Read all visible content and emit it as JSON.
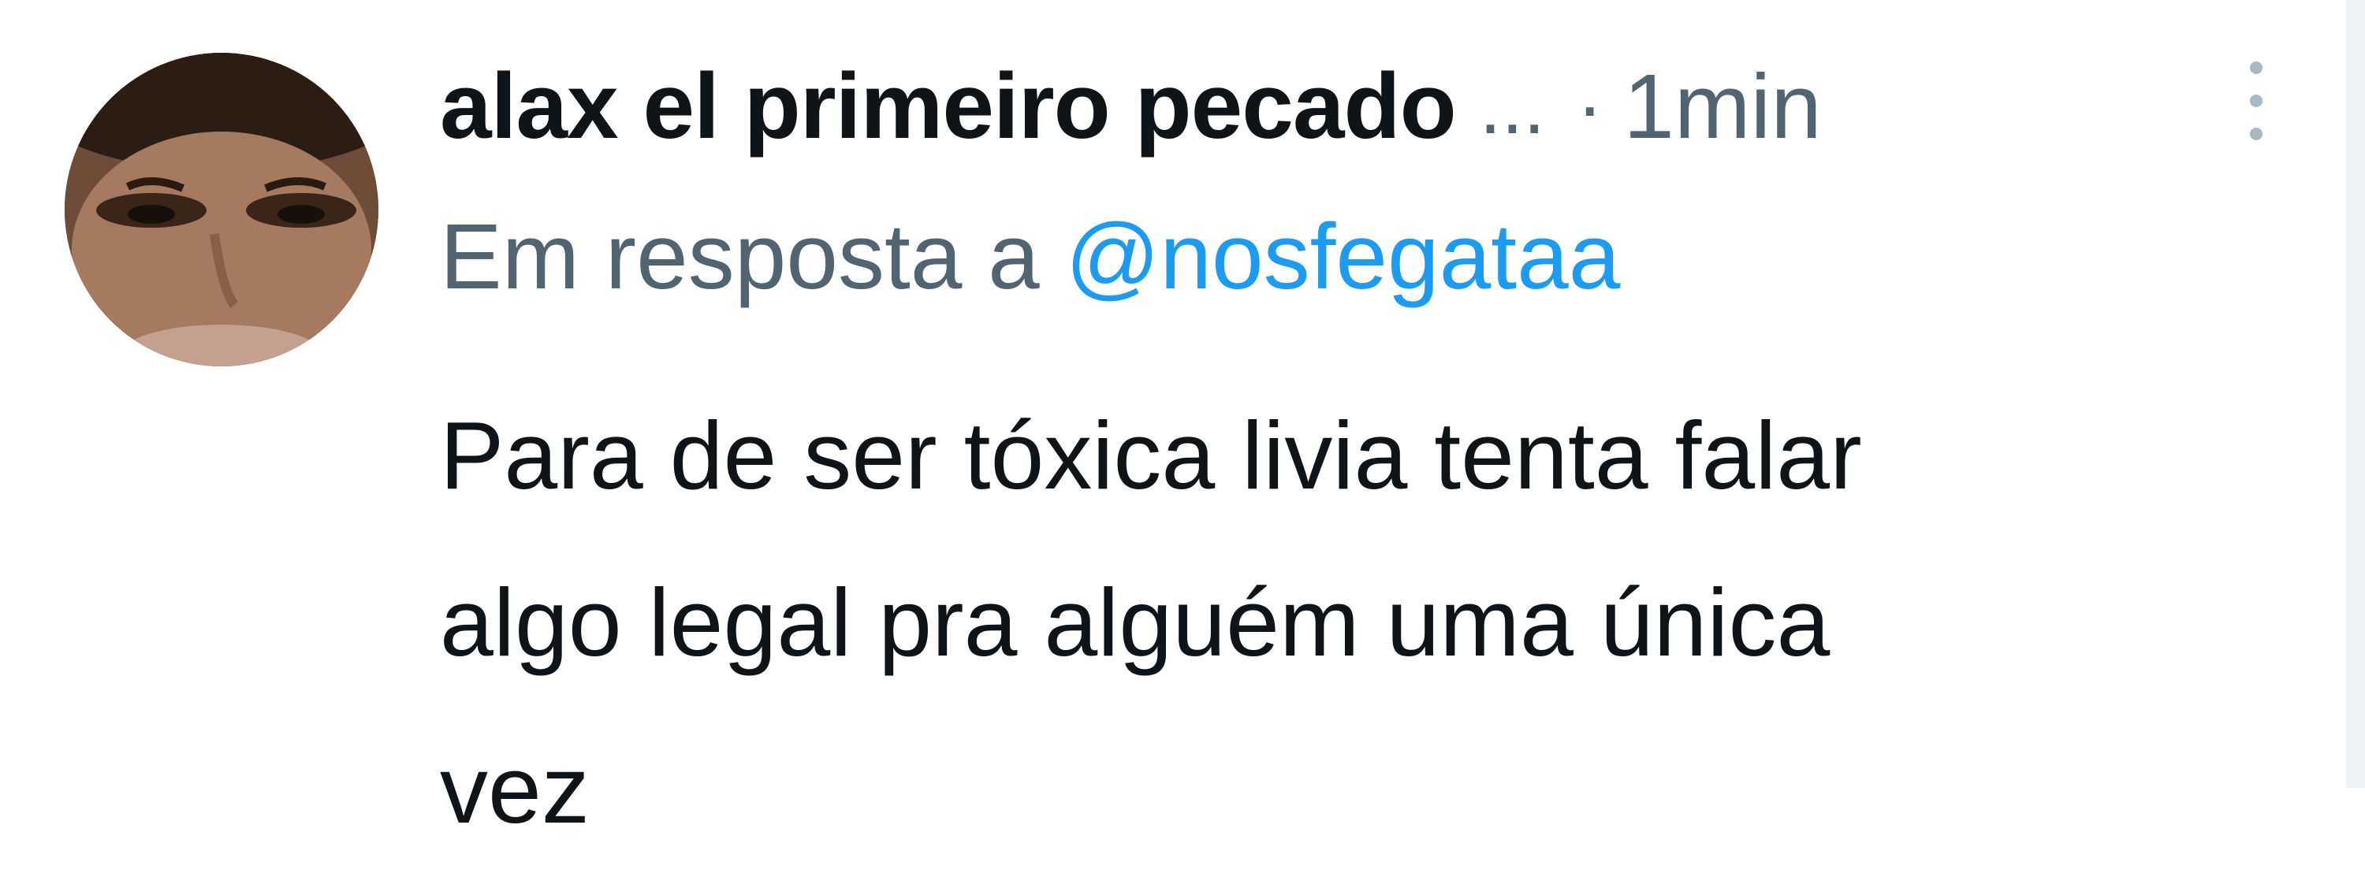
{
  "tweet": {
    "author": {
      "display_name": "alax el primeiro pecado",
      "truncation": "...",
      "avatar_icon": "profile-photo"
    },
    "separator": "·",
    "timestamp": "1min",
    "more_icon": "vertical-ellipsis-icon",
    "reply_context": {
      "prefix": "Em resposta a",
      "mention": "@nosfegataa"
    },
    "text_lines": [
      "Para de ser tóxica livia tenta falar",
      "algo legal pra alguém uma única",
      "vez"
    ]
  },
  "colors": {
    "primary_text": "#0f1419",
    "secondary_text": "#536471",
    "mention": "#1d9bf0",
    "more_dots": "#aab8c2"
  }
}
